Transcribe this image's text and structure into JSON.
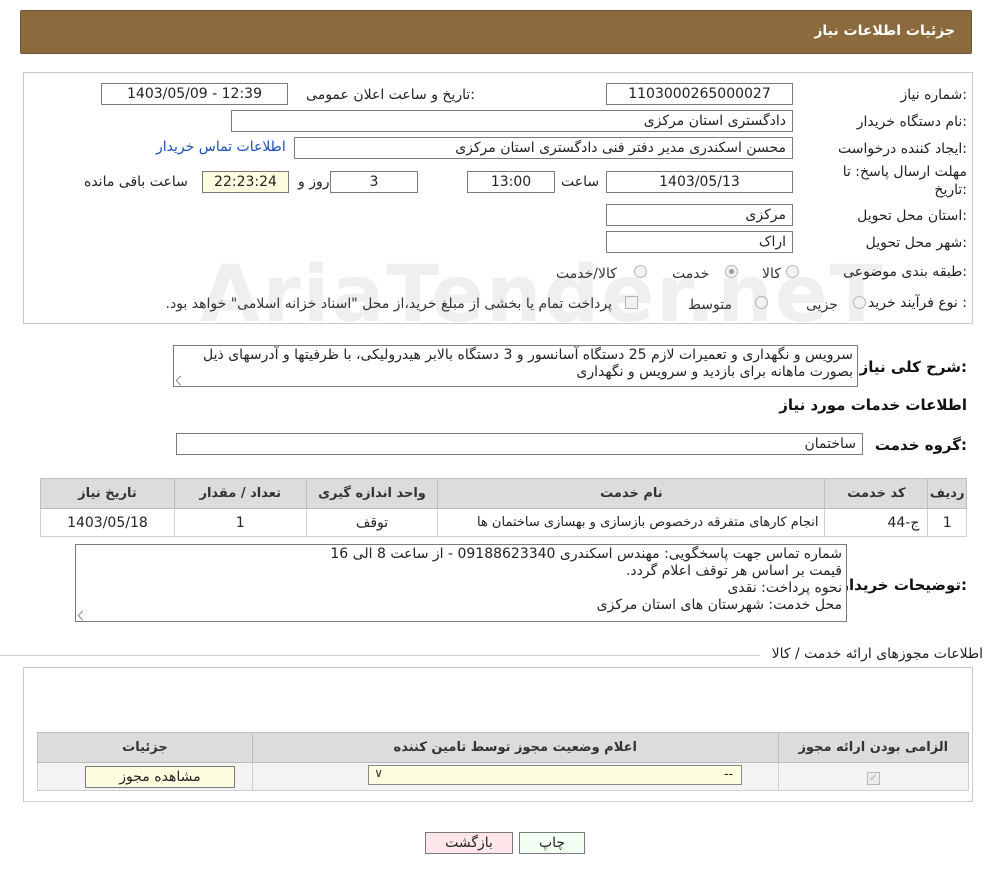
{
  "header": {
    "title": "جزئیات اطلاعات نیاز"
  },
  "form": {
    "need_number_label": "شماره نیاز:",
    "need_number": "1103000265000027",
    "announce_label": "تاریخ و ساعت اعلان عمومی:",
    "announce_value": "1403/05/09 - 12:39",
    "buyer_org_label": "نام دستگاه خریدار:",
    "buyer_org": "دادگستری استان مرکزی",
    "creator_label": "ایجاد کننده درخواست:",
    "creator": "محسن اسکندری مدیر دفتر فنی دادگستری استان مرکزی",
    "buyer_contact_link": "اطلاعات تماس خریدار",
    "deadline_label_1": "مهلت ارسال پاسخ: تا",
    "deadline_label_2": "تاریخ:",
    "deadline_date": "1403/05/13",
    "time_label": "ساعت",
    "deadline_time": "13:00",
    "days_value": "3",
    "days_label": "روز و",
    "remaining_time": "22:23:24",
    "remaining_label": "ساعت باقی مانده",
    "province_label": "استان محل تحویل:",
    "province": "مرکزی",
    "city_label": "شهر محل تحویل:",
    "city": "اراک",
    "category_label": "طبقه بندی موضوعی:",
    "category_options": [
      "کالا",
      "خدمت",
      "کالا/خدمت"
    ],
    "purchase_type_label": "نوع فرآیند خرید :",
    "purchase_options": [
      "جزیی",
      "متوسط"
    ],
    "purchase_note": "پرداخت تمام یا بخشی از مبلغ خرید،از محل \"اسناد خزانه اسلامی\" خواهد بود."
  },
  "description": {
    "label": "شرح کلی نیاز:",
    "text": "سرویس و نگهداری و تعمیرات لازم 25 دستگاه آسانسور  و 3 دستگاه بالابر هیدرولیکی، با ظرفیتها و آدرسهای ذیل بصورت ماهانه برای بازدید و سرویس و نگهداری"
  },
  "services": {
    "section_title": "اطلاعات خدمات مورد نیاز",
    "group_label": "گروه خدمت:",
    "group_value": "ساختمان",
    "columns": [
      "ردیف",
      "کد خدمت",
      "نام خدمت",
      "واحد اندازه گیری",
      "تعداد / مقدار",
      "تاریخ نیاز"
    ],
    "rows": [
      {
        "row": "1",
        "code": "ج-44",
        "name": "انجام کارهای متفرقه درخصوص بازسازی و بهسازی ساختمان ها",
        "unit": "توقف",
        "qty": "1",
        "date": "1403/05/18"
      }
    ]
  },
  "buyer_notes": {
    "label": "توضیحات خریدار:",
    "lines": [
      "شماره تماس جهت پاسخگویی: مهندس اسکندری 09188623340 - از ساعت 8 الی 16",
      "قیمت بر اساس هر توقف اعلام گردد.",
      "نحوه پرداخت: نقدی",
      "محل خدمت: شهرستان های استان مرکزی"
    ]
  },
  "permits": {
    "section_title": "اطلاعات مجوزهای ارائه خدمت / کالا",
    "columns": [
      "الزامی بودن ارائه مجوز",
      "اعلام وضعیت مجوز توسط تامین کننده",
      "جزئیات"
    ],
    "select_value": "--",
    "view_button": "مشاهده مجوز"
  },
  "buttons": {
    "print": "چاپ",
    "back": "بازگشت"
  },
  "watermark": "AriaTender.neT"
}
